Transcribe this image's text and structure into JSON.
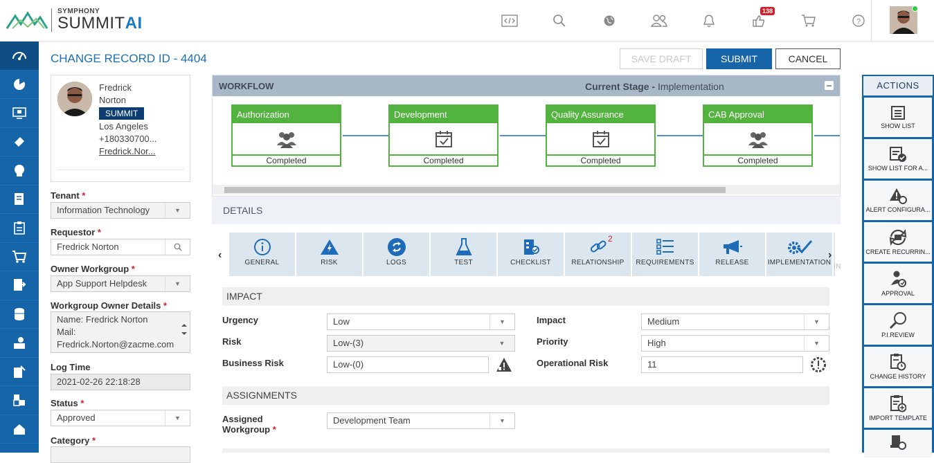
{
  "header": {
    "logo_top": "SYMPHONY",
    "logo_main": "SUMMIT",
    "logo_ai": "AI",
    "notification_count": "138"
  },
  "page": {
    "title": "CHANGE RECORD ID - 4404",
    "save_draft": "SAVE DRAFT",
    "submit": "SUBMIT",
    "cancel": "CANCEL"
  },
  "user": {
    "first": "Fredrick",
    "last": "Norton",
    "tag": "SUMMIT",
    "city": "Los Angeles",
    "phone": "+180330700...",
    "email": "Fredrick.Nor..."
  },
  "form": {
    "tenant_label": "Tenant",
    "tenant_value": "Information Technology",
    "requestor_label": "Requestor",
    "requestor_value": "Fredrick Norton",
    "owner_wg_label": "Owner Workgroup",
    "owner_wg_value": "App Support Helpdesk",
    "wg_owner_label": "Workgroup Owner Details",
    "wg_owner_line1": "Name: Fredrick Norton",
    "wg_owner_line2": "Mail:",
    "wg_owner_line3": "Fredrick.Norton@zacme.com",
    "logtime_label": "Log Time",
    "logtime_value": "2021-02-26 22:18:28",
    "status_label": "Status",
    "status_value": "Approved",
    "category_label": "Category",
    "required_mark": "*"
  },
  "workflow": {
    "title": "WORKFLOW",
    "stage_label": "Current Stage -",
    "stage_value": "Implementation",
    "nodes": [
      {
        "name": "Authorization",
        "status": "Completed"
      },
      {
        "name": "Development",
        "status": "Completed"
      },
      {
        "name": "Quality Assurance",
        "status": "Completed"
      },
      {
        "name": "CAB Approval",
        "status": "Completed"
      }
    ]
  },
  "details": {
    "title": "DETAILS",
    "tabs": [
      {
        "label": "GENERAL",
        "icon": "info-icon"
      },
      {
        "label": "RISK",
        "icon": "warning-bolt-icon"
      },
      {
        "label": "LOGS",
        "icon": "sync-icon"
      },
      {
        "label": "TEST",
        "icon": "flask-icon"
      },
      {
        "label": "CHECKLIST",
        "icon": "checklist-icon"
      },
      {
        "label": "RELATIONSHIP",
        "icon": "link-icon",
        "count": "2"
      },
      {
        "label": "REQUIREMENTS",
        "icon": "list-icon"
      },
      {
        "label": "RELEASE",
        "icon": "megaphone-icon"
      },
      {
        "label": "IMPLEMENTATION",
        "icon": "gear-check-icon"
      },
      {
        "label": "IN",
        "icon": ""
      }
    ],
    "impact_section": "IMPACT",
    "urgency_label": "Urgency",
    "urgency_value": "Low",
    "impact_label": "Impact",
    "impact_value": "Medium",
    "risk_label": "Risk",
    "risk_value": "Low-(3)",
    "priority_label": "Priority",
    "priority_value": "High",
    "business_risk_label": "Business Risk",
    "business_risk_value": "Low-(0)",
    "operational_risk_label": "Operational Risk",
    "operational_risk_value": "11",
    "assignments_section": "ASSIGNMENTS",
    "assigned_wg_label_1": "Assigned",
    "assigned_wg_label_2": "Workgroup",
    "assigned_wg_value": "Development Team"
  },
  "actions": {
    "title": "ACTIONS",
    "items": [
      {
        "label": "SHOW LIST",
        "icon": "list-icon"
      },
      {
        "label": "SHOW LIST FOR A...",
        "icon": "list-check-icon"
      },
      {
        "label": "ALERT CONFIGURA...",
        "icon": "alert-gear-icon"
      },
      {
        "label": "CREATE RECURRIN...",
        "icon": "recurring-icon"
      },
      {
        "label": "APPROVAL",
        "icon": "approval-icon"
      },
      {
        "label": "P.I.REVIEW",
        "icon": "magnifier-icon"
      },
      {
        "label": "CHANGE HISTORY",
        "icon": "history-icon"
      },
      {
        "label": "IMPORT TEMPLATE",
        "icon": "import-icon"
      }
    ]
  }
}
